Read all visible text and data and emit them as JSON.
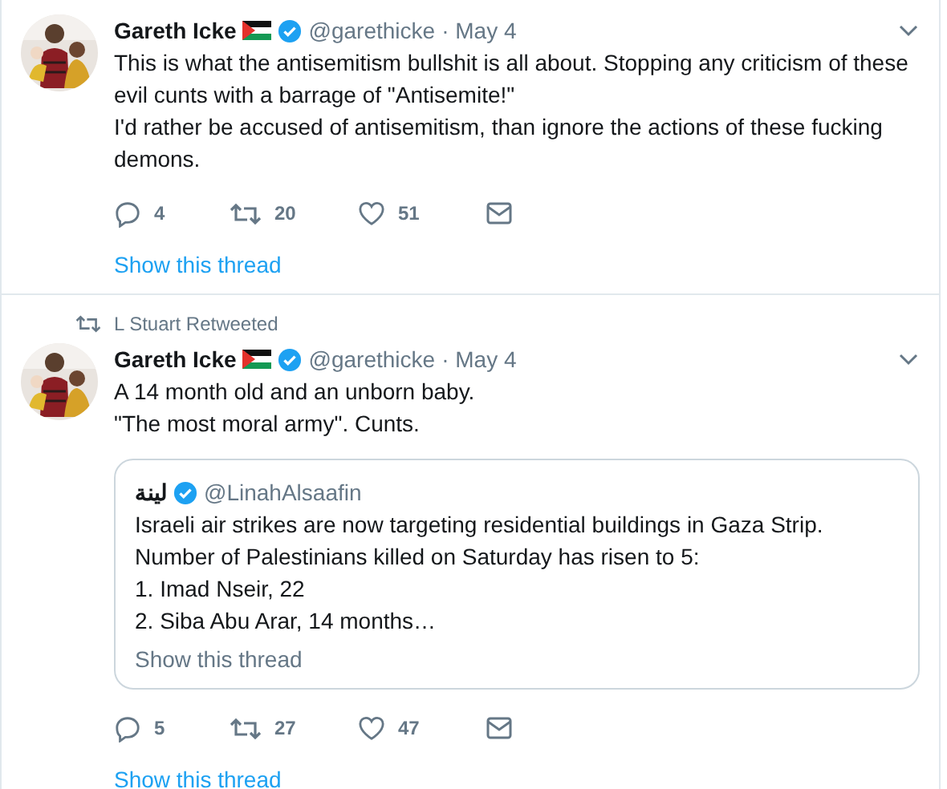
{
  "tweets": [
    {
      "author": {
        "name": "Gareth Icke",
        "verified": true,
        "handle": "@garethicke",
        "date": "· May 4"
      },
      "text_lines": [
        "This is what the antisemitism bullshit is all about. Stopping any criticism of these evil cunts with a barrage of \"Antisemite!\"",
        "I'd rather be accused of antisemitism, than ignore the actions of these fucking demons."
      ],
      "actions": {
        "replies": "4",
        "retweets": "20",
        "likes": "51"
      },
      "thread_link": "Show this thread"
    },
    {
      "retweeted_by": "L Stuart Retweeted",
      "author": {
        "name": "Gareth Icke",
        "verified": true,
        "handle": "@garethicke",
        "date": "· May 4"
      },
      "text_lines": [
        "A 14 month old and an unborn baby.",
        "\"The most moral army\". Cunts."
      ],
      "quote": {
        "name": "لينة",
        "verified": true,
        "handle": "@LinahAlsaafin",
        "text_lines": [
          "Israeli air strikes are now targeting residential buildings in Gaza Strip.",
          "Number of Palestinians killed on Saturday has risen to 5:",
          "1. Imad Nseir, 22",
          "2. Siba Abu Arar, 14 months…"
        ],
        "thread_link": "Show this thread"
      },
      "actions": {
        "replies": "5",
        "retweets": "27",
        "likes": "47"
      },
      "thread_link": "Show this thread"
    }
  ]
}
